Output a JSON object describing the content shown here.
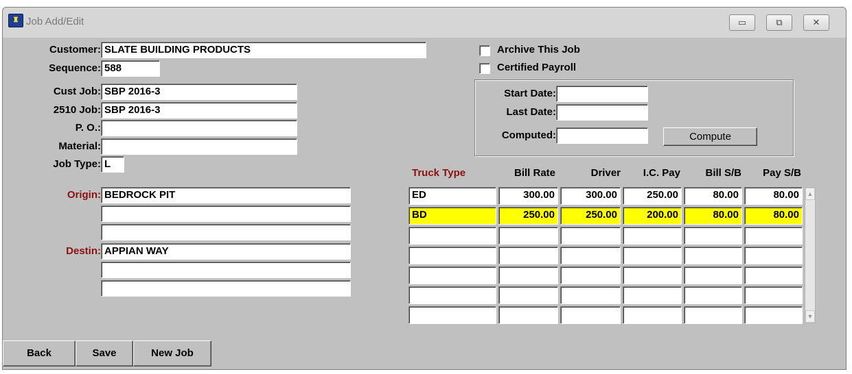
{
  "window": {
    "title": "Job Add/Edit",
    "minimize_glyph": "▭",
    "restore_glyph": "⧉",
    "close_glyph": "✕"
  },
  "labels": {
    "customer": "Customer:",
    "sequence": "Sequence:",
    "cust_job": "Cust Job:",
    "job_2510": "2510 Job:",
    "po": "P. O.:",
    "material": "Material:",
    "job_type": "Job Type:",
    "origin": "Origin:",
    "destin": "Destin:"
  },
  "fields": {
    "customer": "SLATE BUILDING PRODUCTS",
    "sequence": "588",
    "cust_job": "SBP 2016-3",
    "job_2510": "SBP 2016-3",
    "po": "",
    "material": "",
    "job_type": "L",
    "origin": [
      "BEDROCK PIT",
      "",
      ""
    ],
    "destin": [
      "APPIAN WAY",
      "",
      ""
    ]
  },
  "checkboxes": {
    "archive_label": "Archive This Job",
    "archive_checked": false,
    "certified_label": "Certified Payroll",
    "certified_checked": false
  },
  "dates": {
    "start_label": "Start Date:",
    "last_label": "Last Date:",
    "computed_label": "Computed:",
    "start_value": "",
    "last_value": "",
    "computed_value": "",
    "compute_button": "Compute"
  },
  "rates": {
    "headers": [
      "Truck Type",
      "Bill Rate",
      "Driver",
      "I.C. Pay",
      "Bill S/B",
      "Pay S/B"
    ],
    "rows": [
      [
        "ED",
        "300.00",
        "300.00",
        "250.00",
        "80.00",
        "80.00"
      ],
      [
        "BD",
        "250.00",
        "250.00",
        "200.00",
        "80.00",
        "80.00"
      ],
      [
        "",
        "",
        "",
        "",
        "",
        ""
      ],
      [
        "",
        "",
        "",
        "",
        "",
        ""
      ],
      [
        "",
        "",
        "",
        "",
        "",
        ""
      ],
      [
        "",
        "",
        "",
        "",
        "",
        ""
      ],
      [
        "",
        "",
        "",
        "",
        "",
        ""
      ]
    ],
    "highlight_row": 1,
    "highlight_color": "#ffff00",
    "scroll_up_glyph": "▲",
    "scroll_down_glyph": "▼"
  },
  "buttons": {
    "back": "Back",
    "save": "Save",
    "new_job": "New Job"
  },
  "colors": {
    "label_red": "#8b1010",
    "window_bg": "#c0c0c0"
  }
}
